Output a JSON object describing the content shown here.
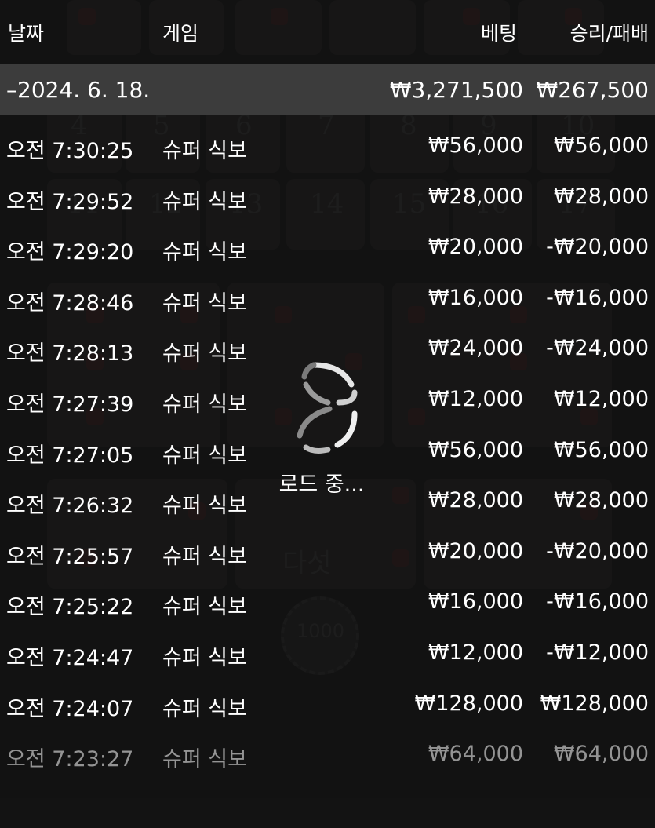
{
  "header": {
    "date_label": "날짜",
    "game_label": "게임",
    "bet_label": "베팅",
    "winloss_label": "승리/패배"
  },
  "date_group": {
    "label": "–2024. 6. 18.",
    "total_bet": "₩3,271,500",
    "total_winloss": "₩267,500"
  },
  "rows": [
    {
      "time": "오전 7:30:25",
      "game": "슈퍼 식보",
      "bet": "₩56,000",
      "winloss": "₩56,000"
    },
    {
      "time": "오전 7:29:52",
      "game": "슈퍼 식보",
      "bet": "₩28,000",
      "winloss": "₩28,000"
    },
    {
      "time": "오전 7:29:20",
      "game": "슈퍼 식보",
      "bet": "₩20,000",
      "winloss": "-₩20,000"
    },
    {
      "time": "오전 7:28:46",
      "game": "슈퍼 식보",
      "bet": "₩16,000",
      "winloss": "-₩16,000"
    },
    {
      "time": "오전 7:28:13",
      "game": "슈퍼 식보",
      "bet": "₩24,000",
      "winloss": "-₩24,000"
    },
    {
      "time": "오전 7:27:39",
      "game": "슈퍼 식보",
      "bet": "₩12,000",
      "winloss": "₩12,000"
    },
    {
      "time": "오전 7:27:05",
      "game": "슈퍼 식보",
      "bet": "₩56,000",
      "winloss": "₩56,000"
    },
    {
      "time": "오전 7:26:32",
      "game": "슈퍼 식보",
      "bet": "₩28,000",
      "winloss": "₩28,000"
    },
    {
      "time": "오전 7:25:57",
      "game": "슈퍼 식보",
      "bet": "₩20,000",
      "winloss": "-₩20,000"
    },
    {
      "time": "오전 7:25:22",
      "game": "슈퍼 식보",
      "bet": "₩16,000",
      "winloss": "-₩16,000"
    },
    {
      "time": "오전 7:24:47",
      "game": "슈퍼 식보",
      "bet": "₩12,000",
      "winloss": "-₩12,000"
    },
    {
      "time": "오전 7:24:07",
      "game": "슈퍼 식보",
      "bet": "₩128,000",
      "winloss": "₩128,000"
    },
    {
      "time": "오전 7:23:27",
      "game": "슈퍼 식보",
      "bet": "₩64,000",
      "winloss": "₩64,000"
    }
  ],
  "loader": {
    "text": "로드 중...",
    "icon": "loading-spinner-icon"
  },
  "background": {
    "board_numbers": [
      "4",
      "5",
      "6",
      "7",
      "8",
      "9",
      "10",
      "11",
      "12",
      "13",
      "14",
      "15",
      "16",
      "17"
    ],
    "board_word": "다섯",
    "chip_value": "1000"
  },
  "colors": {
    "background": "#161616",
    "date_row": "#3c3c3c",
    "text": "#ffffff"
  }
}
